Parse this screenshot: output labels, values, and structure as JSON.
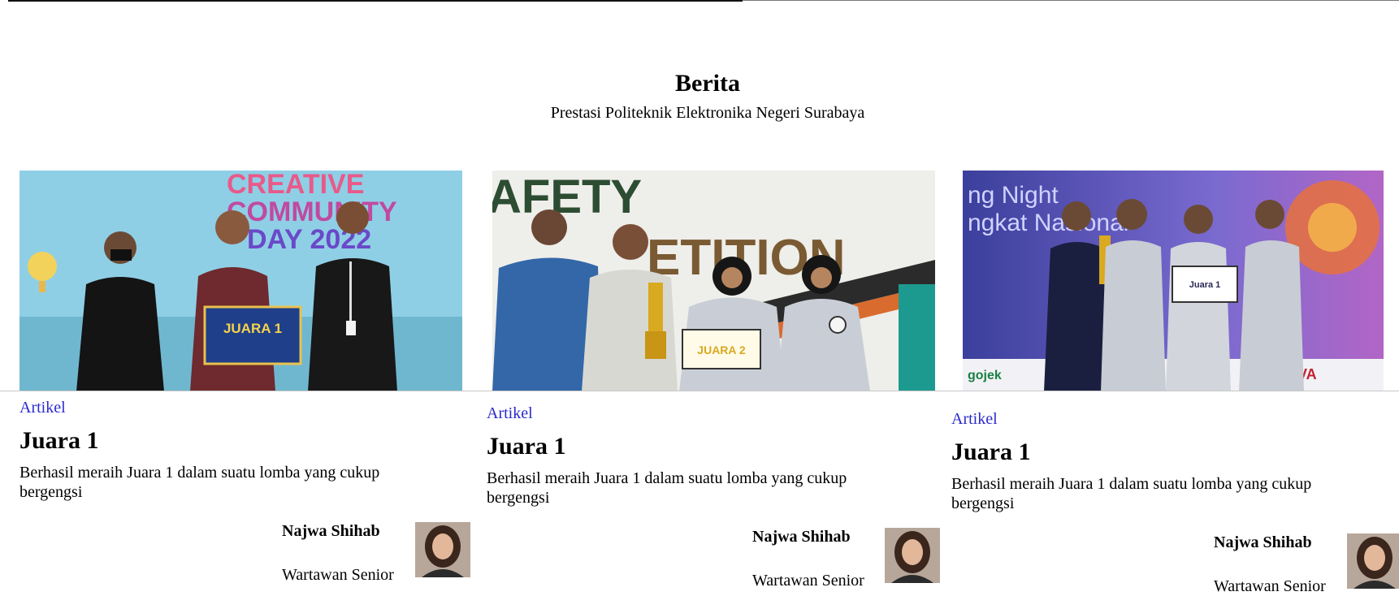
{
  "header": {
    "title": "Berita",
    "subtitle": "Prestasi Politeknik Elektronika Negeri Surabaya"
  },
  "cards": [
    {
      "category": "Artikel",
      "title": "Juara 1",
      "description": "Berhasil meraih Juara 1 dalam suatu lomba yang cukup bergengsi",
      "author_name": "Najwa Shihab",
      "author_role": "Wartawan Senior",
      "image_text": [
        "CREATIVE",
        "COMMUNITY",
        "DAY 2022",
        "JUARA 1"
      ]
    },
    {
      "category": "Artikel",
      "title": "Juara 1",
      "description": "Berhasil meraih Juara 1 dalam suatu lomba yang cukup bergengsi",
      "author_name": "Najwa Shihab",
      "author_role": "Wartawan Senior",
      "image_text": [
        "AFETY",
        "ETITION",
        "JUARA 2"
      ]
    },
    {
      "category": "Artikel",
      "title": "Juara 1",
      "description": "Berhasil meraih Juara 1 dalam suatu lomba yang cukup bergengsi",
      "author_name": "Najwa Shihab",
      "author_role": "Wartawan Senior",
      "image_text": [
        "ng Night",
        "ngkat Nasional",
        "Juara 1",
        "gojek",
        "SIVA"
      ]
    }
  ]
}
